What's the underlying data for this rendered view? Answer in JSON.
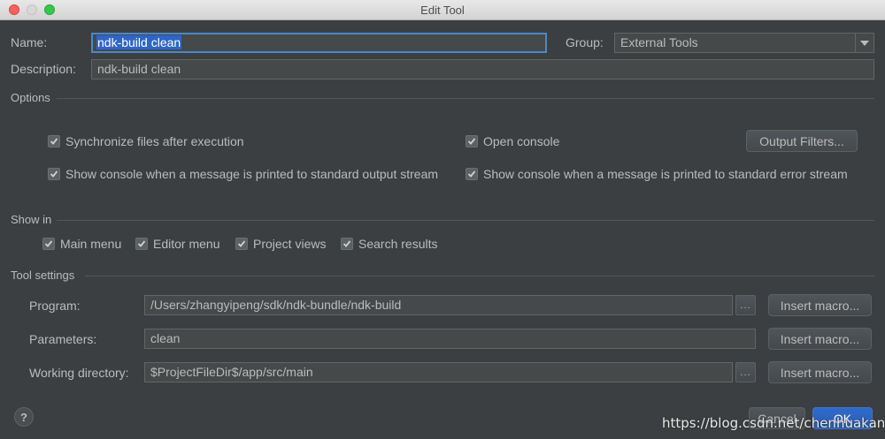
{
  "window": {
    "title": "Edit Tool"
  },
  "name": {
    "label": "Name:",
    "value": "ndk-build clean"
  },
  "group": {
    "label": "Group:",
    "value": "External Tools"
  },
  "description": {
    "label": "Description:",
    "value": "ndk-build clean"
  },
  "options": {
    "title": "Options",
    "synchronize": {
      "label": "Synchronize files after execution",
      "checked": true
    },
    "open_console": {
      "label": "Open console",
      "checked": true
    },
    "console_stdout": {
      "label": "Show console when a message is printed to standard output stream",
      "checked": true
    },
    "console_stderr": {
      "label": "Show console when a message is printed to standard error stream",
      "checked": true
    },
    "output_filters_label": "Output Filters..."
  },
  "show_in": {
    "title": "Show in",
    "items": [
      {
        "label": "Main menu",
        "checked": true
      },
      {
        "label": "Editor menu",
        "checked": true
      },
      {
        "label": "Project views",
        "checked": true
      },
      {
        "label": "Search results",
        "checked": true
      }
    ]
  },
  "tool_settings": {
    "title": "Tool settings",
    "program": {
      "label": "Program:",
      "value": "/Users/zhangyipeng/sdk/ndk-bundle/ndk-build"
    },
    "parameters": {
      "label": "Parameters:",
      "value": "clean"
    },
    "working_directory": {
      "label": "Working directory:",
      "value": "$ProjectFileDir$/app/src/main"
    },
    "browse_label": "...",
    "insert_macro_label": "Insert macro..."
  },
  "footer": {
    "help_label": "?",
    "cancel_label": "Cancel",
    "ok_label": "OK",
    "watermark": "https://blog.csdn.net/chenhuakang"
  },
  "colors": {
    "accent": "#4a88c7",
    "selection": "#2f65ca",
    "ok_button": "#2f6ac9",
    "background": "#3c3f41"
  }
}
